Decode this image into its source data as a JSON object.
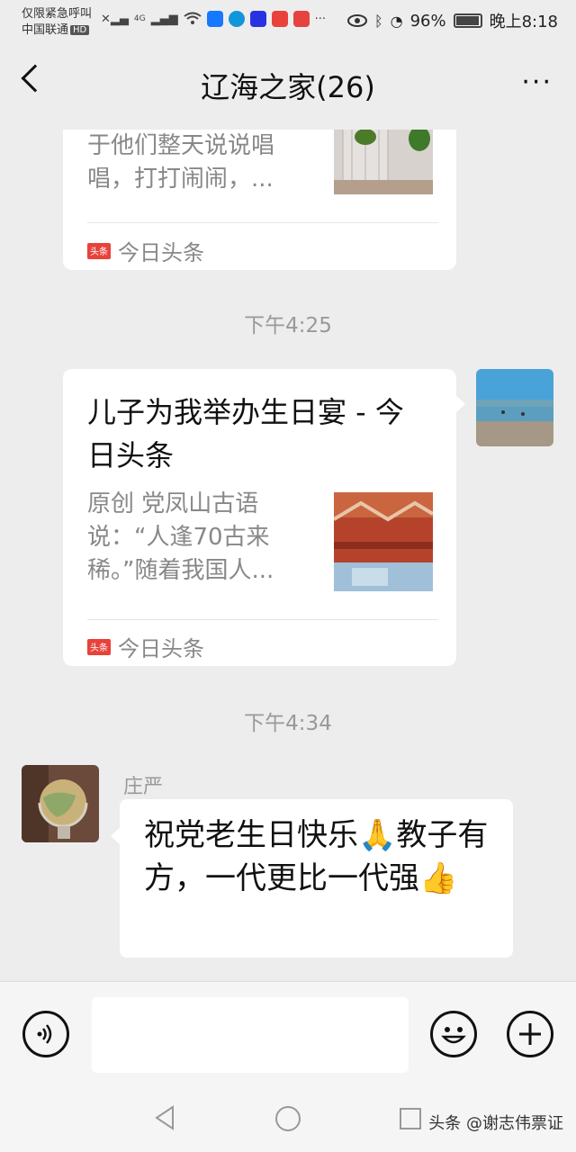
{
  "status_bar": {
    "line1": "仅限紧急呼叫",
    "carrier": "中国联通",
    "hd": "HD",
    "network": "4G",
    "apps": [
      {
        "name": "blue-app-icon",
        "color": "#1677ff"
      },
      {
        "name": "teal-app-icon",
        "color": "#1296db"
      },
      {
        "name": "baidu-icon",
        "color": "#2932e1"
      },
      {
        "name": "toutiao-icon",
        "color": "#e8423b"
      },
      {
        "name": "book-app-icon",
        "color": "#e64340"
      }
    ],
    "battery": "96%",
    "time": "晚上8:18"
  },
  "header": {
    "title": "辽海之家(26)",
    "more_label": "···"
  },
  "messages": {
    "card1": {
      "desc": "于他们整天说说唱唱，打打闹闹，...",
      "source": "今日头条",
      "source_logo": "头条"
    },
    "time1": "下午4:25",
    "card2": {
      "title": "儿子为我举办生日宴 - 今日头条",
      "desc": "原创 党凤山古语说：“人逢70古来稀。”随着我国人...",
      "source": "今日头条",
      "source_logo": "头条"
    },
    "time2": "下午4:34",
    "msg3": {
      "sender": "庄严",
      "text": "祝党老生日快乐🙏教子有方，一代更比一代强👍"
    }
  },
  "input": {
    "placeholder": ""
  },
  "watermark": "头条 @谢志伟票证"
}
